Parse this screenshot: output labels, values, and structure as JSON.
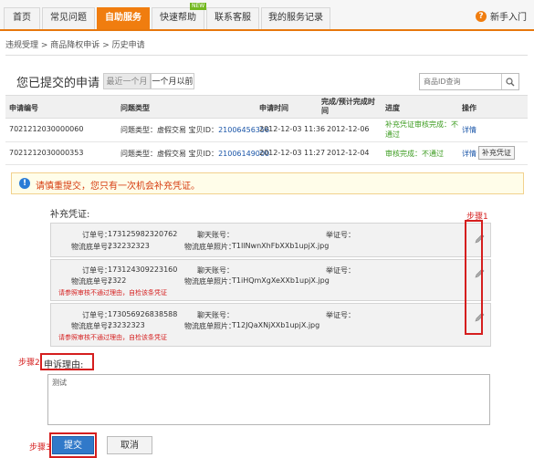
{
  "nav": {
    "tabs": [
      "首页",
      "常见问题",
      "自助服务",
      "快速帮助",
      "联系客服",
      "我的服务记录"
    ],
    "new_badge": "NEW",
    "help_label": "新手入门"
  },
  "breadcrumb": [
    "违规受理",
    "商品降权申诉",
    "历史申请"
  ],
  "page": {
    "title": "您已提交的申请",
    "filter_recent": "最近一个月",
    "filter_older": "一个月以前",
    "search_placeholder": "商品ID查询"
  },
  "table": {
    "headers": [
      "申请编号",
      "问题类型",
      "申请时间",
      "完成/预计完成时间",
      "进度",
      "操作"
    ],
    "rows": [
      {
        "id": "7021212030000060",
        "type_prefix": "问题类型：虚假交易 宝贝ID：",
        "item_id": "21006456356",
        "apply_time": "2012-12-03 11:36",
        "done_time": "2012-12-06",
        "progress_1": "补充凭证审核完成：不",
        "progress_2": "通过",
        "action": "详情"
      },
      {
        "id": "7021212030000353",
        "type_prefix": "问题类型：虚假交易 宝贝ID：",
        "item_id": "21006149000",
        "apply_time": "2012-12-03 11:27",
        "done_time": "2012-12-04",
        "progress_1": "审核完成：不通过",
        "action": "详情",
        "action2": "补充凭证"
      }
    ]
  },
  "warning": "请慎重提交，您只有一次机会补充凭证。",
  "evidence": {
    "section_label": "补充凭证:",
    "labels": {
      "order": "订单号：",
      "logistics": "物流底单号：",
      "chat": "聊天账号：",
      "photo": "物流底单照片：",
      "witness": "举证号："
    },
    "items": [
      {
        "order": "173125982320762",
        "logistics": "232232323",
        "photo": "T1IlNwnXhFbXXb1upjX.jpg",
        "note": ""
      },
      {
        "order": "173124309223160",
        "logistics": "2322",
        "photo": "T1iHQmXgXeXXb1upjX.jpg",
        "note": "请参照审核不通过理由，自检该条凭证"
      },
      {
        "order": "173056926838588",
        "logistics": "23232323",
        "photo": "T12JQaXNjXXb1upjX.jpg",
        "note": "请参照审核不通过理由，自检该条凭证"
      }
    ]
  },
  "steps": {
    "step1": "步骤1",
    "step2": "步骤2",
    "step3": "步骤3"
  },
  "reason": {
    "label": "申诉理由:",
    "value": "测试"
  },
  "buttons": {
    "submit": "提交",
    "cancel": "取消"
  },
  "colors": {
    "accent": "#f07d0f",
    "highlight": "#d51e1e",
    "submit": "#3179c9",
    "link": "#1a55a8"
  }
}
